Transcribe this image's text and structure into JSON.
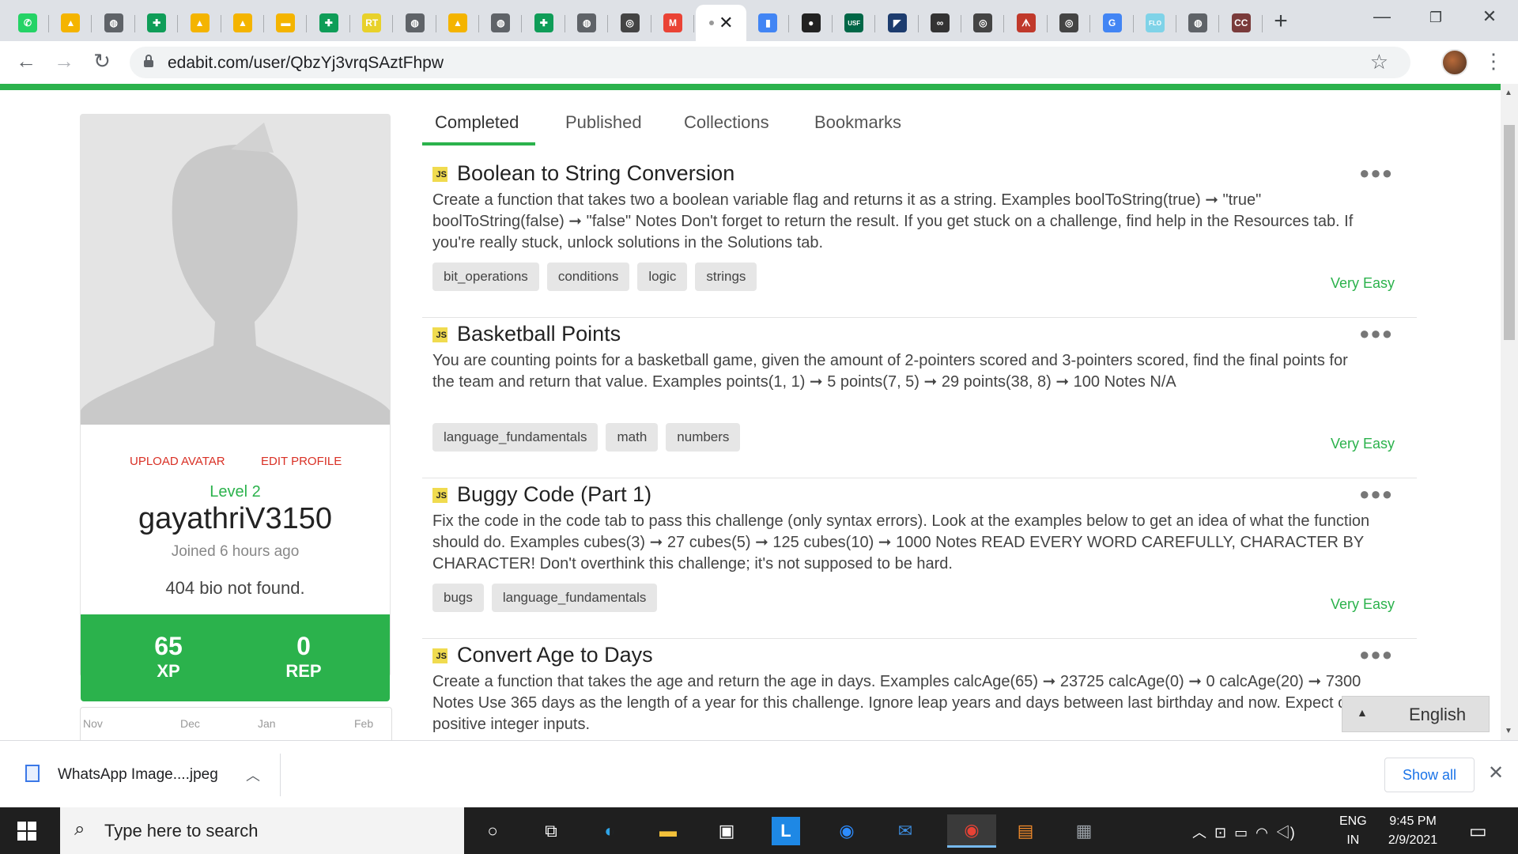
{
  "browser": {
    "tabs": [
      {
        "icon": "whatsapp-icon",
        "glyph": "✆",
        "color": "#25d366"
      },
      {
        "icon": "google-drive-icon",
        "glyph": "▲",
        "color": "#f4b400"
      },
      {
        "icon": "globe-icon",
        "glyph": "◍",
        "color": "#5f6368"
      },
      {
        "icon": "google-sheets-icon",
        "glyph": "✚",
        "color": "#0f9d58"
      },
      {
        "icon": "google-drive-icon",
        "glyph": "▲",
        "color": "#f4b400"
      },
      {
        "icon": "google-drive-icon",
        "glyph": "▲",
        "color": "#f4b400"
      },
      {
        "icon": "google-slides-icon",
        "glyph": "▬",
        "color": "#f4b400"
      },
      {
        "icon": "google-sheets-icon",
        "glyph": "✚",
        "color": "#0f9d58"
      },
      {
        "icon": "rt-icon",
        "glyph": "RT",
        "color": "#e8d12a"
      },
      {
        "icon": "globe-icon",
        "glyph": "◍",
        "color": "#5f6368"
      },
      {
        "icon": "google-drive-icon",
        "glyph": "▲",
        "color": "#f4b400"
      },
      {
        "icon": "globe-icon",
        "glyph": "◍",
        "color": "#5f6368"
      },
      {
        "icon": "google-sheets-icon",
        "glyph": "✚",
        "color": "#0f9d58"
      },
      {
        "icon": "globe-icon",
        "glyph": "◍",
        "color": "#5f6368"
      },
      {
        "icon": "spiral-icon",
        "glyph": "◎",
        "color": "#444444"
      },
      {
        "icon": "gmail-icon",
        "glyph": "M",
        "color": "#ea4335"
      }
    ],
    "active_tab": {
      "icon": "edabit-icon"
    },
    "tabs_after": [
      {
        "icon": "chart-icon",
        "glyph": "▮",
        "color": "#4285f4"
      },
      {
        "icon": "github-icon",
        "glyph": "●",
        "color": "#222222"
      },
      {
        "icon": "usf-icon",
        "glyph": "USF",
        "color": "#006747"
      },
      {
        "icon": "book-icon",
        "glyph": "◤",
        "color": "#1d3c6e"
      },
      {
        "icon": "colab-icon",
        "glyph": "∞",
        "color": "#333333"
      },
      {
        "icon": "spiral-icon",
        "glyph": "◎",
        "color": "#444444"
      },
      {
        "icon": "people-icon",
        "glyph": "ᗑ",
        "color": "#c0392b"
      },
      {
        "icon": "spiral-icon",
        "glyph": "◎",
        "color": "#444444"
      },
      {
        "icon": "google-icon",
        "glyph": "G",
        "color": "#4285f4"
      },
      {
        "icon": "flo-icon",
        "glyph": "FLO",
        "color": "#7fd3e8"
      },
      {
        "icon": "globe-icon",
        "glyph": "◍",
        "color": "#5f6368"
      },
      {
        "icon": "cc-icon",
        "glyph": "CC",
        "color": "#7a3b3b"
      }
    ],
    "url": "edabit.com/user/QbzYj3vrqSAztFhpw"
  },
  "profile": {
    "upload_avatar": "UPLOAD AVATAR",
    "edit_profile": "EDIT PROFILE",
    "level": "Level 2",
    "username": "gayathriV3150",
    "joined": "Joined 6 hours ago",
    "bio": "404 bio not found.",
    "xp_value": "65",
    "xp_label": "XP",
    "rep_value": "0",
    "rep_label": "REP",
    "calendar_months": [
      "Nov",
      "Dec",
      "Jan",
      "Feb"
    ]
  },
  "tabs": [
    "Completed",
    "Published",
    "Collections",
    "Bookmarks"
  ],
  "active_tab": "Completed",
  "js_badge": "JS",
  "challenges": [
    {
      "title": "Boolean to String Conversion",
      "description": "Create a function that takes two a boolean variable flag and returns it as a string. Examples boolToString(true) ➞ \"true\" boolToString(false) ➞ \"false\" Notes Don't forget to return the result. If you get stuck on a challenge, find help in the Resources tab. If you're really stuck, unlock solutions in the Solutions tab.",
      "tags": [
        "bit_operations",
        "conditions",
        "logic",
        "strings"
      ],
      "difficulty": "Very Easy"
    },
    {
      "title": "Basketball Points",
      "description": "You are counting points for a basketball game, given the amount of 2-pointers scored and 3-pointers scored, find the final points for the team and return that value. Examples points(1, 1) ➞ 5 points(7, 5) ➞ 29 points(38, 8) ➞ 100 Notes N/A",
      "tags": [
        "language_fundamentals",
        "math",
        "numbers"
      ],
      "difficulty": "Very Easy"
    },
    {
      "title": "Buggy Code (Part 1)",
      "description": "Fix the code in the code tab to pass this challenge (only syntax errors). Look at the examples below to get an idea of what the function should do. Examples cubes(3) ➞ 27 cubes(5) ➞ 125 cubes(10) ➞ 1000 Notes READ EVERY WORD CAREFULLY, CHARACTER BY CHARACTER! Don't overthink this challenge; it's not supposed to be hard.",
      "tags": [
        "bugs",
        "language_fundamentals"
      ],
      "difficulty": "Very Easy"
    },
    {
      "title": "Convert Age to Days",
      "description": "Create a function that takes the age and return the age in days. Examples calcAge(65) ➞ 23725 calcAge(0) ➞ 0 calcAge(20) ➞ 7300 Notes Use 365 days as the length of a year for this challenge. Ignore leap years and days between last birthday and now. Expect only positive integer inputs.",
      "tags": [],
      "difficulty": ""
    }
  ],
  "language_widget": "English",
  "downloads": {
    "file_name": "WhatsApp Image....jpeg",
    "show_all": "Show all"
  },
  "taskbar": {
    "search_placeholder": "Type here to search",
    "lang_line1": "ENG",
    "lang_line2": "IN",
    "time": "9:45 PM",
    "date": "2/9/2021"
  },
  "colors": {
    "brand_green": "#2bb24c",
    "red_link": "#d93025"
  }
}
